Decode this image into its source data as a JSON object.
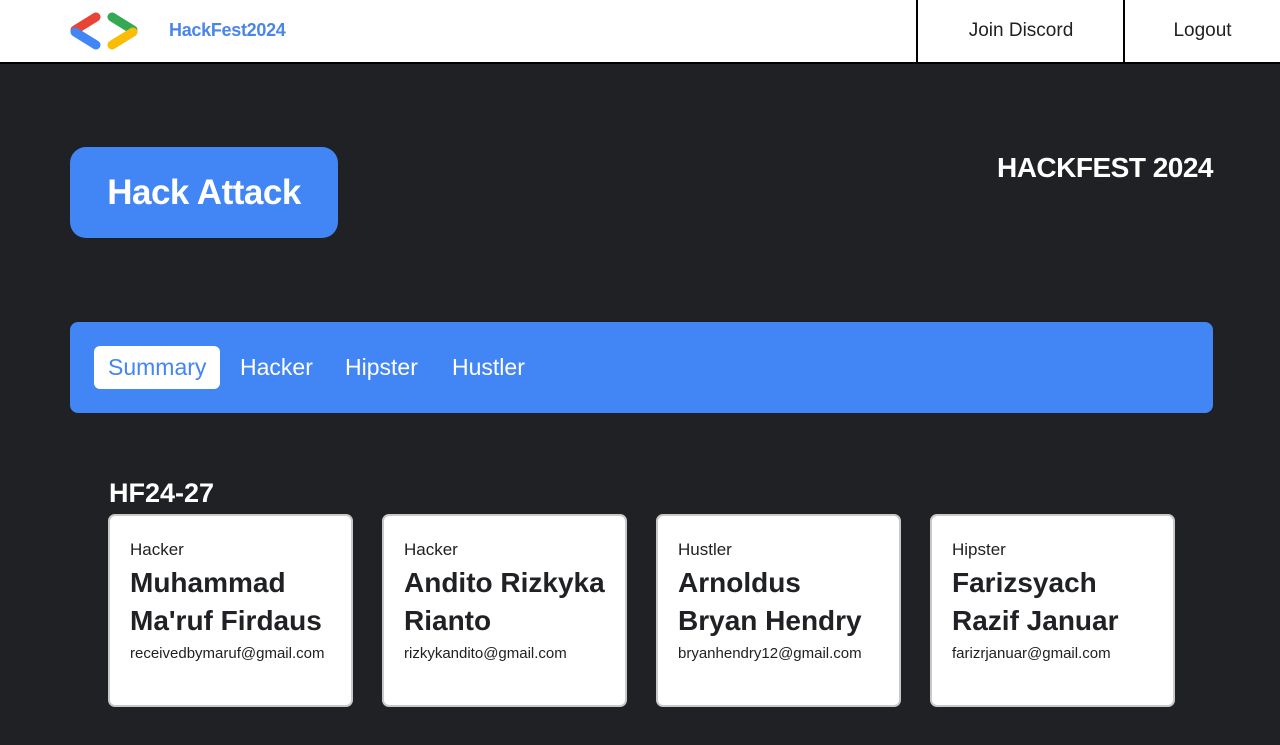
{
  "header": {
    "brand": "HackFest2024",
    "join_discord": "Join Discord",
    "logout": "Logout",
    "logo_icon": "code-brackets-icon",
    "logo_colors": [
      "#ea4335",
      "#4285f4",
      "#34a853",
      "#fbbc04"
    ]
  },
  "hero": {
    "badge": "Hack Attack",
    "event_title": "HACKFEST 2024"
  },
  "tabs": [
    {
      "label": "Summary",
      "active": true
    },
    {
      "label": "Hacker",
      "active": false
    },
    {
      "label": "Hipster",
      "active": false
    },
    {
      "label": "Hustler",
      "active": false
    }
  ],
  "team": {
    "id": "HF24-27",
    "members": [
      {
        "role": "Hacker",
        "name": "Muhammad Ma'ruf Firdaus",
        "email": "receivedbymaruf@gmail.com"
      },
      {
        "role": "Hacker",
        "name": "Andito Rizkyka Rianto",
        "email": "rizkykandito@gmail.com"
      },
      {
        "role": "Hustler",
        "name": "Arnoldus Bryan Hendry",
        "email": "bryanhendry12@gmail.com"
      },
      {
        "role": "Hipster",
        "name": "Farizsyach Razif Januar",
        "email": "farizrjanuar@gmail.com"
      }
    ]
  },
  "colors": {
    "accent": "#4285f4",
    "background": "#202124"
  }
}
